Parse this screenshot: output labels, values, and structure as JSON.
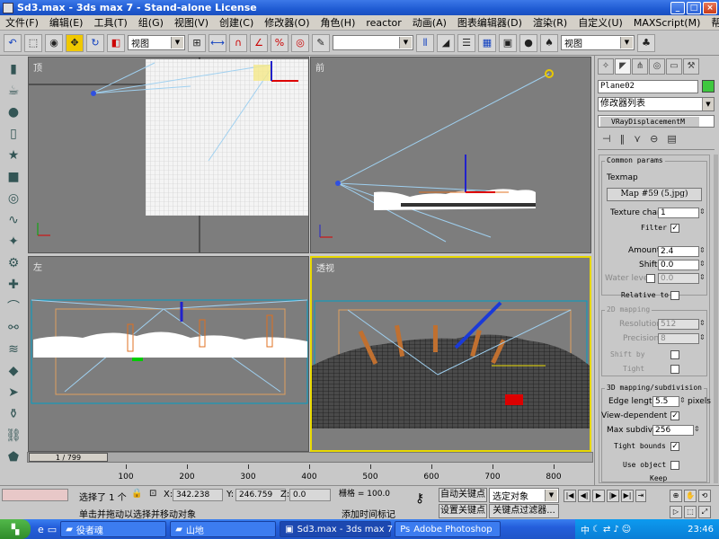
{
  "window": {
    "title": "Sd3.max - 3ds max 7 - Stand-alone License",
    "minimize": "_",
    "maximize": "□",
    "close": "×"
  },
  "menu": [
    "文件(F)",
    "编辑(E)",
    "工具(T)",
    "组(G)",
    "视图(V)",
    "创建(C)",
    "修改器(O)",
    "角色(H)",
    "reactor",
    "动画(A)",
    "图表编辑器(D)",
    "渲染(R)",
    "自定义(U)",
    "MAXScript(M)",
    "帮助(H)"
  ],
  "toolbar": {
    "view_select_left": "视图",
    "view_select_right": "视图",
    "selection_set": ""
  },
  "viewports": {
    "top": "顶",
    "front": "前",
    "left": "左",
    "perspective": "透视"
  },
  "command_panel": {
    "object_name": "Plane02",
    "modifier_list": "修改器列表",
    "stack_item": "VRayDisplacementM",
    "common_params": "Common params",
    "texmap_label": "Texmap",
    "map_button": "Map #59 (5.jpg)",
    "texture_chan_label": "Texture chan",
    "texture_chan_value": "1",
    "filter_label": "Filter",
    "amount_label": "Amount",
    "amount_value": "2.4",
    "shift_label": "Shift",
    "shift_value": "0.0",
    "water_level_label": "Water level",
    "water_level_value": "0.0",
    "relative_to_label": "Relative to",
    "mapping_2d": "2D mapping",
    "resolution_label": "Resolution",
    "resolution_value": "512",
    "precision_label": "Precision",
    "precision_value": "8",
    "shift_by_label": "Shift by",
    "tight_label": "Tight",
    "mapping_3d": "3D mapping/subdivision",
    "edge_length_label": "Edge length",
    "edge_length_value": "5.5",
    "pixels_label": "pixels",
    "view_dependent_label": "View-dependent",
    "max_subdivs_label": "Max subdivs",
    "max_subdivs_value": "256",
    "tight_bounds_label": "Tight bounds",
    "use_object_label": "Use object",
    "keep_label": "Keep"
  },
  "timeline": {
    "slider": "1 / 799",
    "ticks": [
      "100",
      "200",
      "300",
      "400",
      "500",
      "600",
      "700",
      "800"
    ]
  },
  "status": {
    "selected": "选择了 1 个",
    "x_label": "X:",
    "x_value": "342.238",
    "y_label": "Y:",
    "y_value": "246.759",
    "z_label": "Z:",
    "z_value": "0.0",
    "grid": "栅格 = 100.0",
    "auto_key": "自动关键点",
    "selection_combo": "选定对象",
    "set_key": "设置关键点",
    "key_filters": "关键点过滤器...",
    "prompt": "单击并拖动以选择并移动对象",
    "add_time_tag": "添加时间标记"
  },
  "taskbar": {
    "tasks": [
      "役者魂",
      "山地",
      "Sd3.max - 3ds max 7 ...",
      "Adobe Photoshop"
    ],
    "ime": "中",
    "clock": "23:46"
  }
}
